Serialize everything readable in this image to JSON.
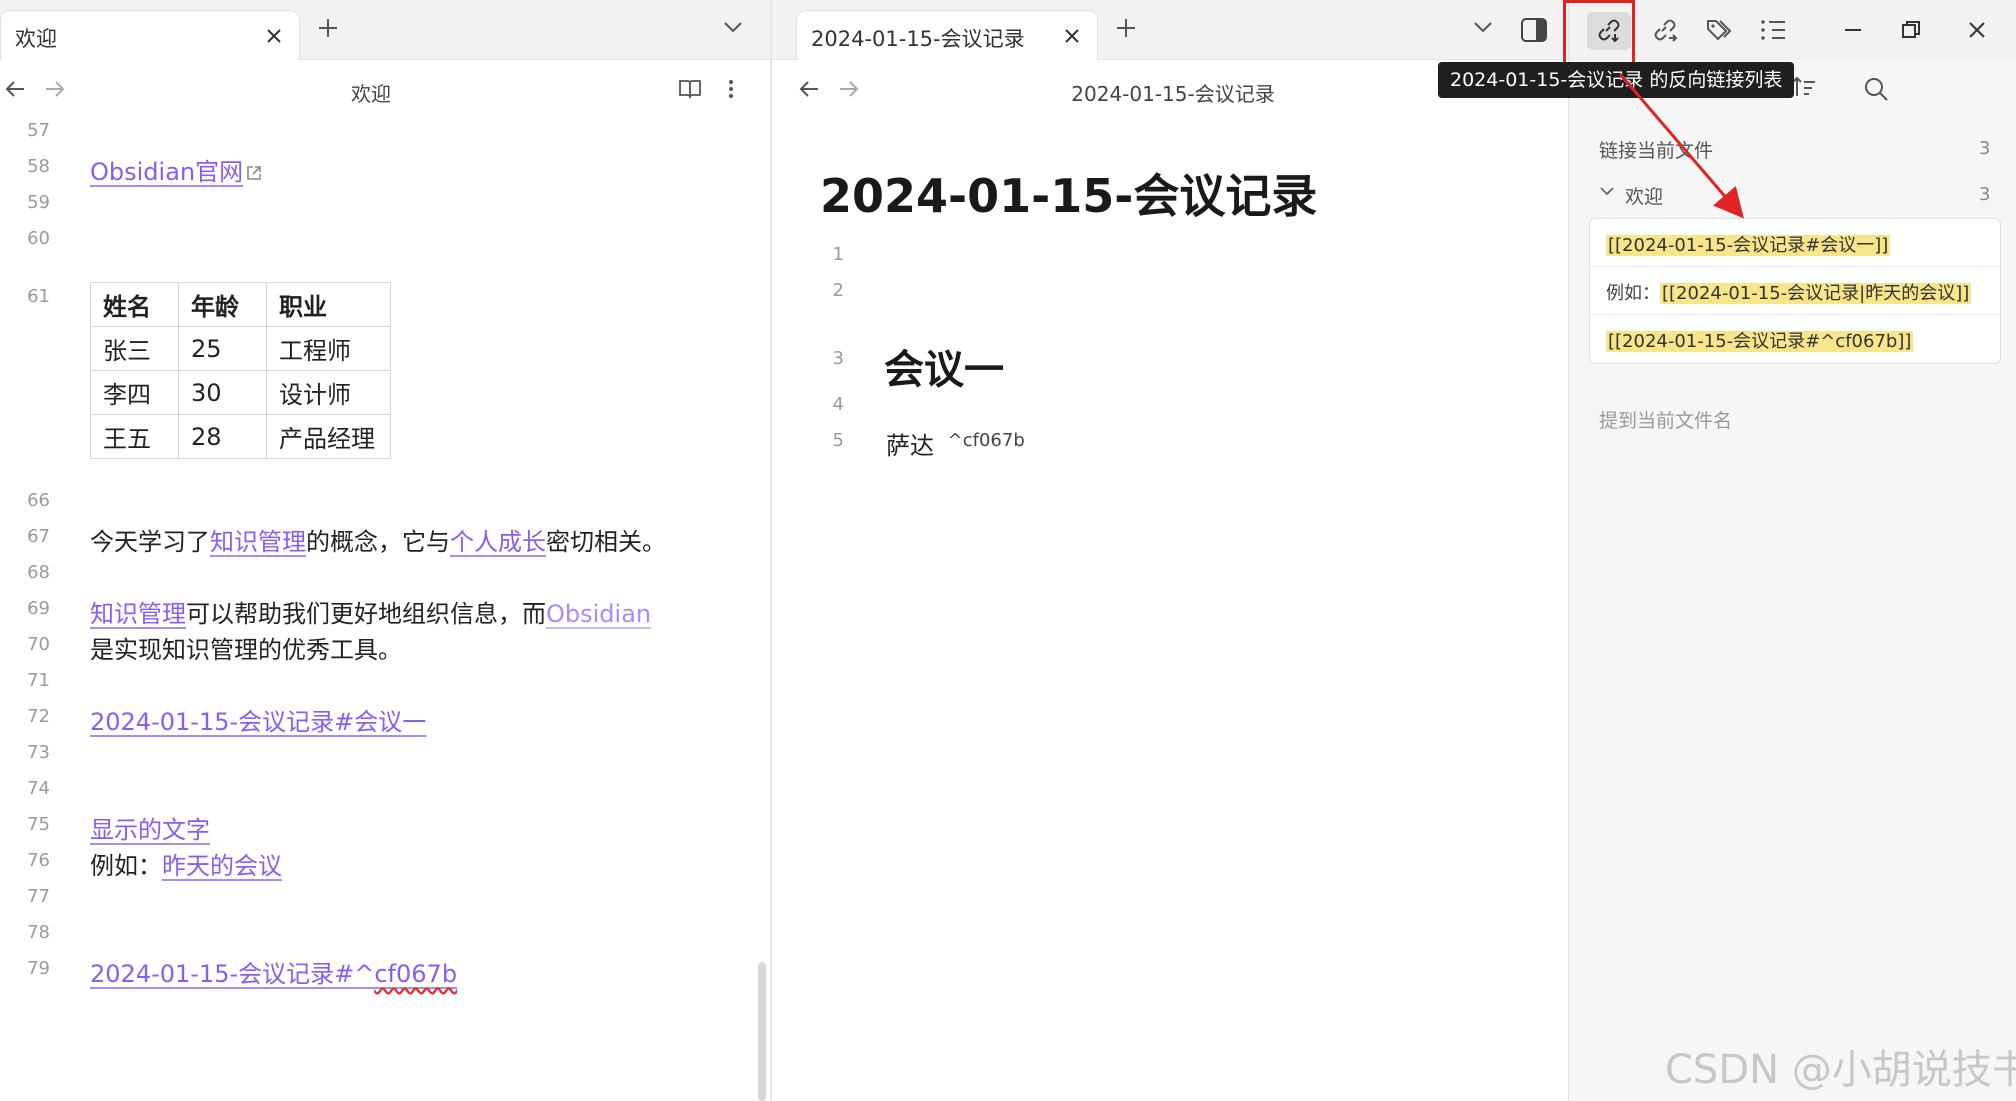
{
  "left": {
    "tab": {
      "label": "欢迎"
    },
    "header": {
      "title": "欢迎"
    },
    "lines": {
      "n57": "57",
      "n58": "58",
      "n59": "59",
      "n60": "60",
      "n61": "61",
      "n66": "66",
      "n67": "67",
      "n68": "68",
      "n69": "69",
      "n70": "70",
      "n71": "71",
      "n72": "72",
      "n73": "73",
      "n74": "74",
      "n75": "75",
      "n76": "76",
      "n77": "77",
      "n78": "78",
      "n79": "79"
    },
    "content": {
      "obsidian_link": "Obsidian官网",
      "p67_a": "今天学习了",
      "p67_link1": "知识管理",
      "p67_b": "的概念，它与",
      "p67_link2": "个人成长",
      "p67_c": "密切相关。",
      "p69_link": "知识管理",
      "p69_a": "可以帮助我们更好地组织信息，而",
      "p69_link2": "Obsidian",
      "p70": "是实现知识管理的优秀工具。",
      "p72_link": "2024-01-15-会议记录#会议一",
      "p75_link": "显示的文字",
      "p76_a": "例如：",
      "p76_link": "昨天的会议",
      "p79_link_a": "2024-01-15-会议记录#^",
      "p79_link_b": "cf067b"
    },
    "table": {
      "headers": [
        "姓名",
        "年龄",
        "职业"
      ],
      "rows": [
        [
          "张三",
          "25",
          "工程师"
        ],
        [
          "李四",
          "30",
          "设计师"
        ],
        [
          "王五",
          "28",
          "产品经理"
        ]
      ]
    }
  },
  "center": {
    "tab": {
      "label": "2024-01-15-会议记录"
    },
    "header": {
      "title": "2024-01-15-会议记录"
    },
    "title": "2024-01-15-会议记录",
    "lines": {
      "n1": "1",
      "n2": "2",
      "n3": "3",
      "n4": "4",
      "n5": "5"
    },
    "heading": "会议一",
    "body_text": "萨达",
    "block_id": "^cf067b"
  },
  "right": {
    "tooltip": "2024-01-15-会议记录 的反向链接列表",
    "linked_label": "链接当前文件",
    "linked_count": "3",
    "group_label": "欢迎",
    "group_count": "3",
    "results": [
      {
        "prefix": "",
        "highlight": "[[2024-01-15-会议记录#会议一]]"
      },
      {
        "prefix": "例如：",
        "highlight": "[[2024-01-15-会议记录|昨天的会议]]"
      },
      {
        "prefix": "",
        "highlight": "[[2024-01-15-会议记录#^cf067b]]"
      }
    ],
    "unlinked_label": "提到当前文件名"
  },
  "watermark": "CSDN @小胡说技书",
  "colors": {
    "link": "#8a5cf5",
    "highlight": "#f7e58a",
    "annotation": "#e02424"
  }
}
